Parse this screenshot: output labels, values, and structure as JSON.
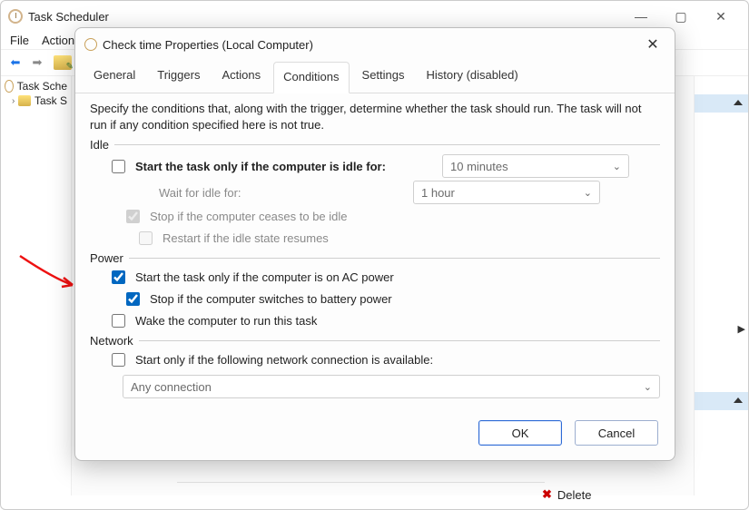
{
  "app": {
    "title": "Task Scheduler"
  },
  "menu": {
    "file": "File",
    "action": "Action"
  },
  "tree": {
    "root": "Task Sche",
    "child": "Task S"
  },
  "actions": {
    "delete": "Delete"
  },
  "dialog": {
    "title": "Check time Properties (Local Computer)",
    "tabs": {
      "general": "General",
      "triggers": "Triggers",
      "actions": "Actions",
      "conditions": "Conditions",
      "settings": "Settings",
      "history": "History (disabled)"
    },
    "intro": "Specify the conditions that, along with the trigger, determine whether the task should run.  The task will not run  if any condition specified here is not true.",
    "idle": {
      "group": "Idle",
      "start_only_idle": "Start the task only if the computer is idle for:",
      "idle_for_value": "10 minutes",
      "wait_label": "Wait for idle for:",
      "wait_value": "1 hour",
      "stop_ceases": "Stop if the computer ceases to be idle",
      "restart_resumes": "Restart if the idle state resumes"
    },
    "power": {
      "group": "Power",
      "ac": "Start the task only if the computer is on AC power",
      "battery": "Stop if the computer switches to battery power",
      "wake": "Wake the computer to run this task"
    },
    "network": {
      "group": "Network",
      "only_if": "Start only if the following network connection is available:",
      "value": "Any connection"
    },
    "buttons": {
      "ok": "OK",
      "cancel": "Cancel"
    }
  }
}
